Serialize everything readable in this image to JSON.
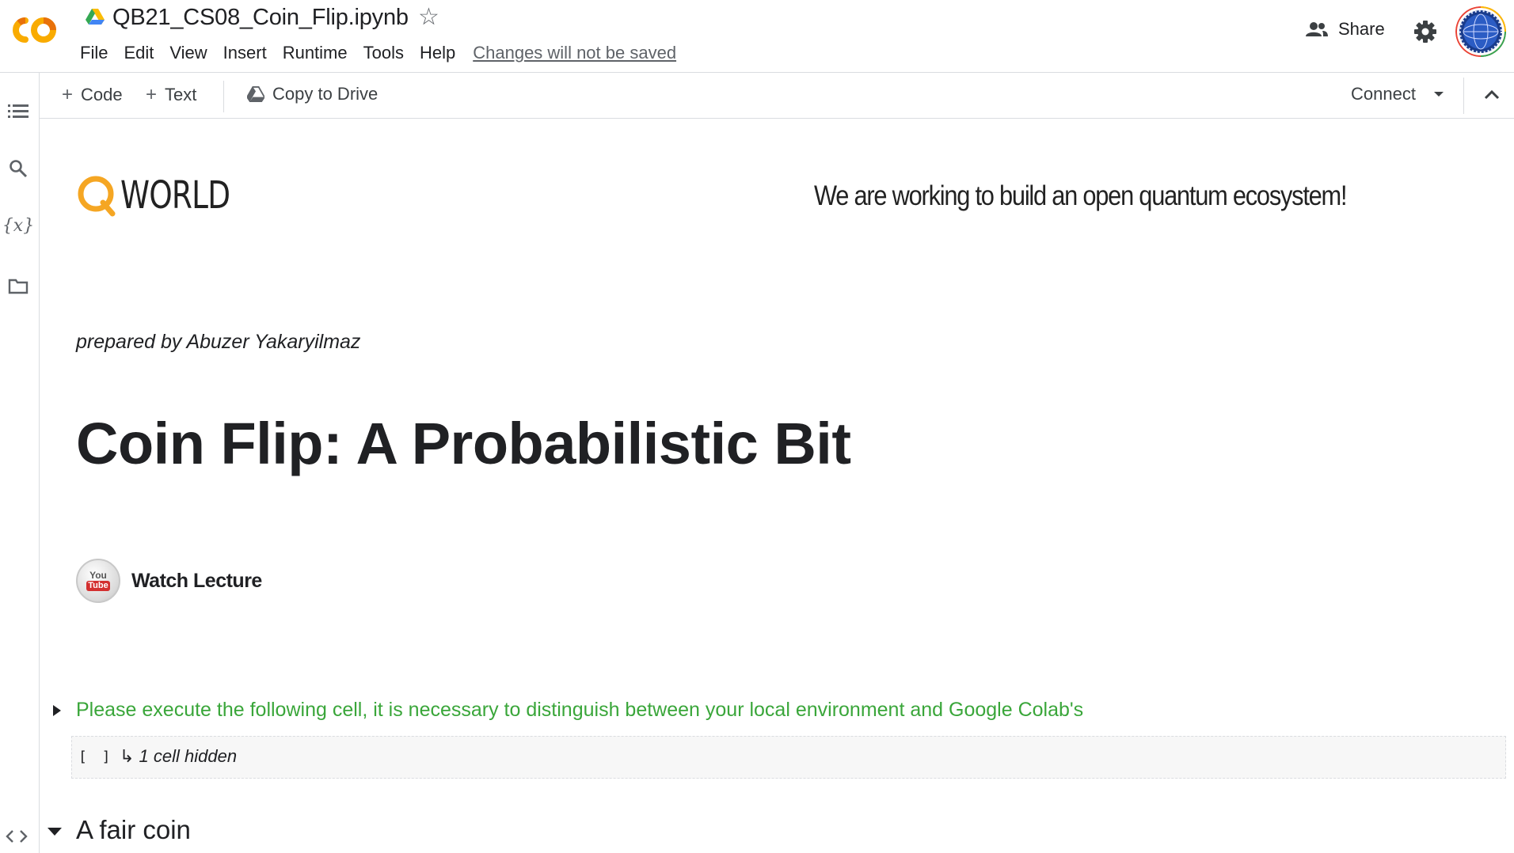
{
  "header": {
    "notebook_title": "QB21_CS08_Coin_Flip.ipynb",
    "menu": [
      "File",
      "Edit",
      "View",
      "Insert",
      "Runtime",
      "Tools",
      "Help"
    ],
    "unsaved_notice": "Changes will not be saved",
    "share_label": "Share"
  },
  "toolbar": {
    "code_label": "Code",
    "text_label": "Text",
    "copy_to_drive_label": "Copy to Drive",
    "connect_label": "Connect"
  },
  "content": {
    "logo_text": "WORLD",
    "tagline": "We are working to build an open quantum ecosystem!",
    "prepared_by": "prepared by Abuzer Yakaryilmaz",
    "title": "Coin Flip: A Probabilistic Bit",
    "watch_lecture": "Watch Lecture",
    "youtube_you": "You",
    "youtube_tube": "Tube",
    "exec_note": "Please execute the following cell, it is necessary to distinguish between your local environment and Google Colab's",
    "run_brackets": "[ ]",
    "hidden_cells": "↳ 1 cell hidden",
    "section_heading": "A fair coin"
  },
  "colors": {
    "brand_orange": "#F9AB00",
    "brand_orange_dark": "#E8710A",
    "green_text": "#3aa63a",
    "qworld_orange": "#F5A623"
  },
  "icons": {
    "rail": [
      "table-of-contents-icon",
      "search-icon",
      "variables-icon",
      "files-icon",
      "code-snippets-icon"
    ]
  }
}
